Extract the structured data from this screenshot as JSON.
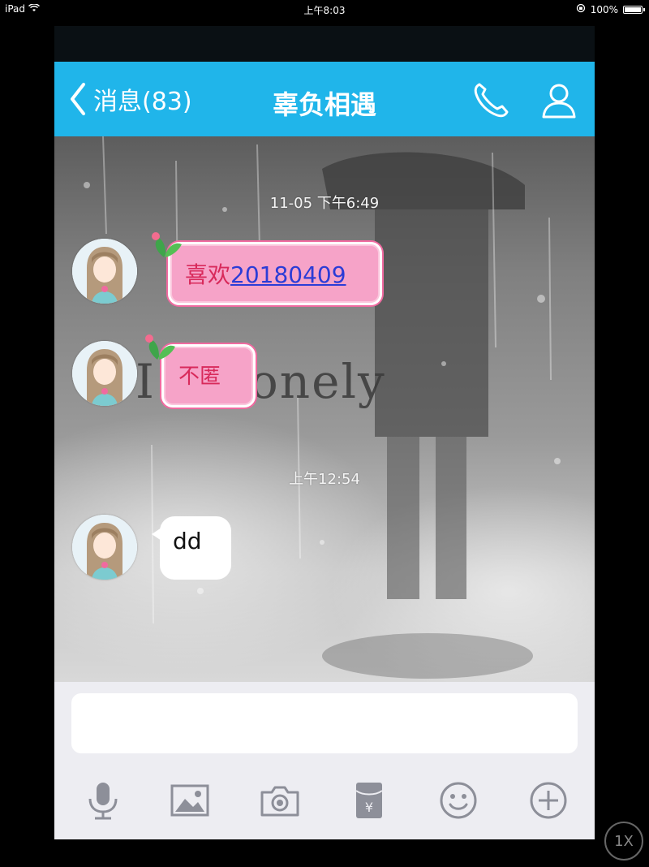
{
  "status_bar": {
    "device": "iPad",
    "time": "上午8:03",
    "battery": "100%",
    "battery_level": 1.0
  },
  "header": {
    "back_label": "消息(83)",
    "title": "辜负相遇",
    "icons": [
      "phone-icon",
      "contact-icon"
    ]
  },
  "chat": {
    "background_overlay_text": "I'm lonely",
    "messages": [
      {
        "type": "timestamp",
        "text": "11-05 下午6:49"
      },
      {
        "type": "incoming",
        "style": "pink",
        "prefix": "喜欢",
        "link": "20180409"
      },
      {
        "type": "incoming",
        "style": "pink",
        "text": "不匿"
      },
      {
        "type": "timestamp",
        "text": "上午12:54"
      },
      {
        "type": "incoming",
        "style": "white",
        "text": "dd"
      }
    ]
  },
  "input_bar": {
    "placeholder": "",
    "tools": [
      "microphone-icon",
      "image-icon",
      "camera-icon",
      "red-packet-icon",
      "emoji-icon",
      "plus-icon"
    ]
  },
  "zoom_badge": "1X",
  "colors": {
    "header": "#20b5ea",
    "pink_bubble": "#f6a3c8",
    "pink_text": "#d82a5b",
    "link": "#2b3cd6",
    "input_bar": "#ededf2"
  }
}
